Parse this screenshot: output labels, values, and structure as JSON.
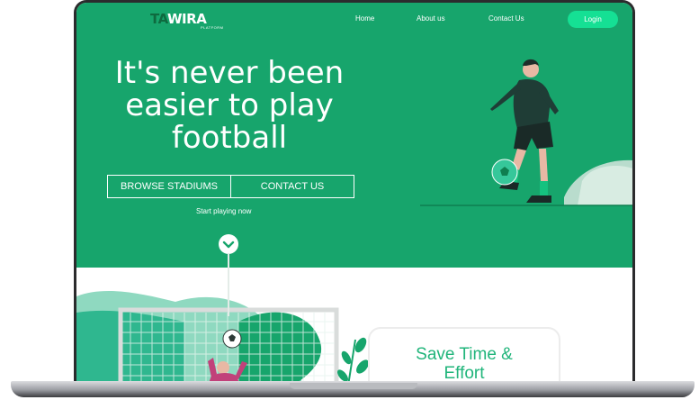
{
  "brand": {
    "logo_main_a": "TA",
    "logo_main_b": "WIRA",
    "logo_sub": "PLATFORM",
    "color": "#17a56c",
    "accent": "#15e094"
  },
  "nav": {
    "items": [
      "Home",
      "About us",
      "Contact Us"
    ],
    "login_label": "Login"
  },
  "hero": {
    "headline_lines": [
      "It's never been",
      "easier to play",
      "football"
    ],
    "browse_label": "BROWSE STADIUMS",
    "contact_label": "CONTACT US",
    "start_text": "Start playing now"
  },
  "card": {
    "title_lines": [
      "Save Time &",
      "Effort"
    ]
  },
  "icons": {
    "scroll": "chevron-down-icon"
  }
}
